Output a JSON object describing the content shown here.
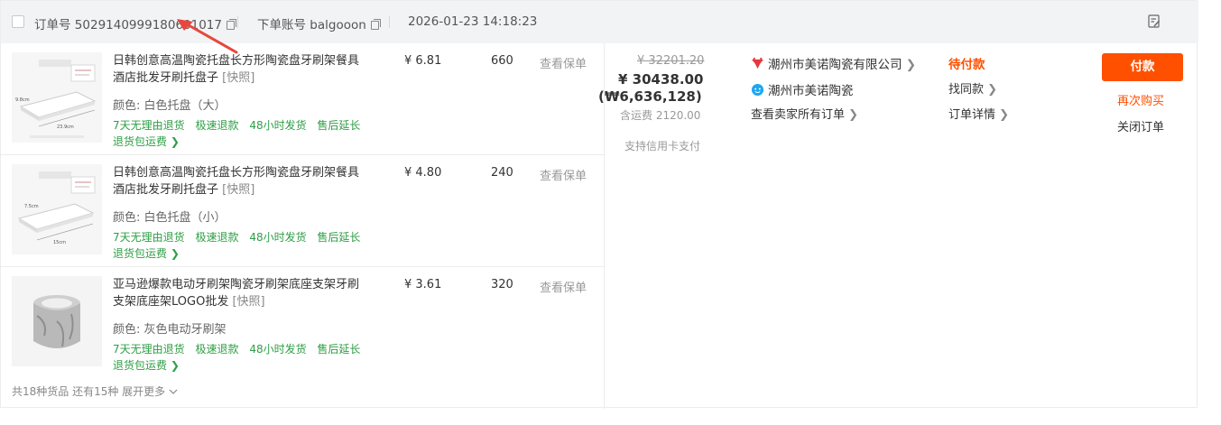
{
  "header": {
    "order_no_label": "订单号",
    "order_no": "5029140999180601017",
    "account_label": "下单账号",
    "account": "balgooon",
    "datetime": "2026-01-23 14:18:23"
  },
  "items": [
    {
      "title": "日韩创意高温陶瓷托盘长方形陶瓷盘牙刷架餐具酒店批发牙刷托盘子",
      "snapshot": "[快照]",
      "color": "颜色: 白色托盘（大）",
      "price": "¥ 6.81",
      "qty": "660",
      "insurance": "查看保单",
      "services": [
        "7天无理由退货",
        "极速退款",
        "48小时发货",
        "售后延长"
      ],
      "return_ship": "退货包运费 ❯"
    },
    {
      "title": "日韩创意高温陶瓷托盘长方形陶瓷盘牙刷架餐具酒店批发牙刷托盘子",
      "snapshot": "[快照]",
      "color": "颜色: 白色托盘（小）",
      "price": "¥ 4.80",
      "qty": "240",
      "insurance": "查看保单",
      "services": [
        "7天无理由退货",
        "极速退款",
        "48小时发货",
        "售后延长"
      ],
      "return_ship": "退货包运费 ❯"
    },
    {
      "title": "亚马逊爆款电动牙刷架陶瓷牙刷架底座支架牙刷支架底座架LOGO批发",
      "snapshot": "[快照]",
      "color": "颜色: 灰色电动牙刷架",
      "price": "¥ 3.61",
      "qty": "320",
      "insurance": "查看保单",
      "services": [
        "7天无理由退货",
        "极速退款",
        "48小时发货",
        "售后延长"
      ],
      "return_ship": "退货包运费 ❯"
    }
  ],
  "more": "共18种货品 还有15种 展开更多",
  "summary": {
    "original": "¥ 32201.20",
    "total": "¥ 30438.00",
    "total_krw": "(₩6,636,128)",
    "shipping": "含运费 2120.00",
    "credit": "支持信用卡支付"
  },
  "seller": {
    "company": "潮州市美诺陶瓷有限公司",
    "shop": "潮州市美诺陶瓷",
    "all_orders": "查看卖家所有订单"
  },
  "status": {
    "label": "待付款",
    "find_similar": "找同款",
    "details": "订单详情"
  },
  "actions": {
    "pay": "付款",
    "rebuy": "再次购买",
    "close": "关闭订单"
  },
  "colors": {
    "accent": "#ff5000",
    "service_green": "#2e9e45",
    "header_bg": "#f2f3f5",
    "annotation_arrow": "#e8473e"
  }
}
